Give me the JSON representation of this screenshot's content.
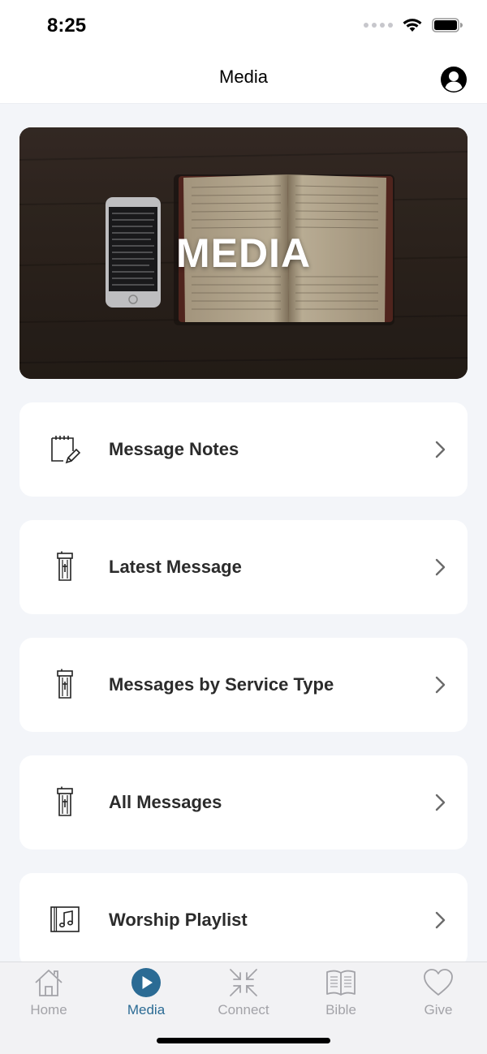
{
  "status": {
    "time": "8:25"
  },
  "nav": {
    "title": "Media"
  },
  "hero": {
    "title": "MEDIA"
  },
  "menu": [
    {
      "label": "Message Notes",
      "icon": "notes-pencil-icon"
    },
    {
      "label": "Latest Message",
      "icon": "pulpit-icon"
    },
    {
      "label": "Messages by Service Type",
      "icon": "pulpit-icon"
    },
    {
      "label": "All Messages",
      "icon": "pulpit-icon"
    },
    {
      "label": "Worship Playlist",
      "icon": "music-note-icon"
    }
  ],
  "tabs": [
    {
      "label": "Home",
      "icon": "house-icon",
      "active": false
    },
    {
      "label": "Media",
      "icon": "play-circle-icon",
      "active": true
    },
    {
      "label": "Connect",
      "icon": "arrows-inward-icon",
      "active": false
    },
    {
      "label": "Bible",
      "icon": "open-book-icon",
      "active": false
    },
    {
      "label": "Give",
      "icon": "heart-icon",
      "active": false
    }
  ],
  "colors": {
    "accent": "#2b6b94",
    "inactive_tab": "#a3a3a8",
    "background": "#f3f5f9",
    "card": "#ffffff"
  }
}
